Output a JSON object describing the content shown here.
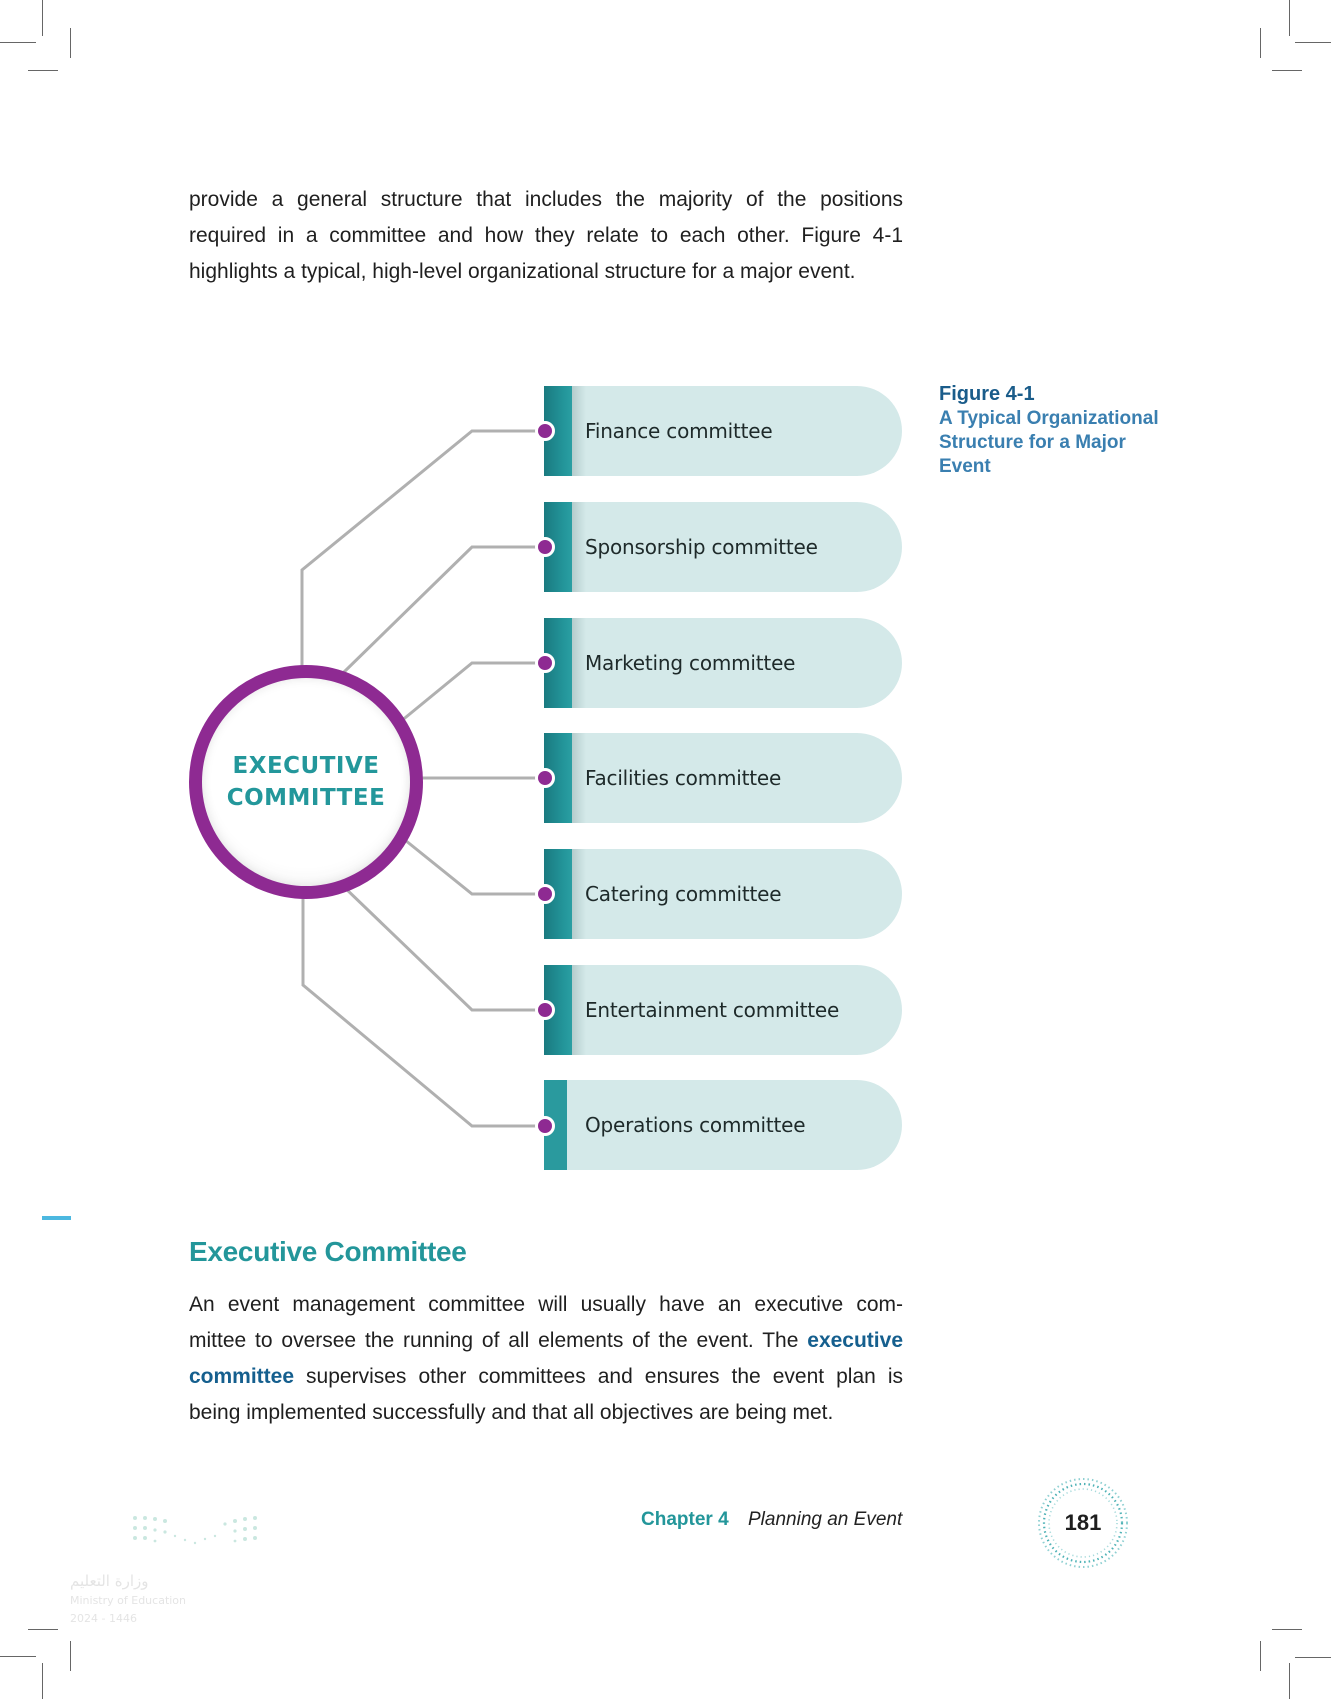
{
  "intro_paragraph": {
    "lines": [
      "provide a general structure that includes the majority of the positions",
      "required in a committee and how they relate to each other. Figure 4-1",
      "highlights a typical, high-level organizational structure for a major event."
    ]
  },
  "figure": {
    "number": "Figure 4-1",
    "title_lines": [
      "A Typical Organizational",
      "Structure for a Major",
      "Event"
    ],
    "center_node": {
      "lines": [
        "EXECUTIVE",
        "COMMITTEE"
      ]
    },
    "committees": [
      {
        "label": "Finance committee"
      },
      {
        "label": "Sponsorship committee"
      },
      {
        "label": "Marketing committee"
      },
      {
        "label": "Facilities committee"
      },
      {
        "label": "Catering committee"
      },
      {
        "label": "Entertainment committee"
      },
      {
        "label": "Operations committee"
      }
    ],
    "colors": {
      "ring": "#8e2a92",
      "center_text": "#23979b",
      "box_fill": "#d4e9e9",
      "box_bar": "#23959a",
      "connector": "#b0b0b0",
      "dot": "#8e2a92"
    }
  },
  "section": {
    "heading": "Executive Committee",
    "paragraph": {
      "line1": "An event management committee will usually have an executive com-",
      "line2_pre": "mittee to oversee the running of all elements of the event. The ",
      "line2_kw": "executive",
      "line3_kw": "committee",
      "line3_post": " supervises other committees and ensures the event plan is",
      "line4": "being implemented successfully and that all objectives are being met."
    }
  },
  "footer": {
    "chapter": "Chapter 4",
    "chapter_title": "Planning an Event",
    "page_number": "181",
    "logo_lines": [
      "وزارة التعليم",
      "Ministry of Education",
      "2024 - 1446"
    ]
  }
}
